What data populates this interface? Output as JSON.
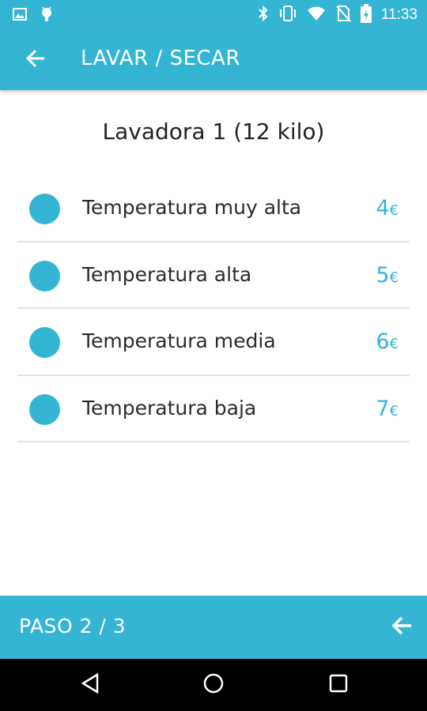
{
  "status_bar": {
    "time": "11:33",
    "left_icons": [
      "image-icon",
      "android-icon"
    ],
    "right_icons": [
      "bluetooth-icon",
      "vibrate-icon",
      "wifi-icon",
      "no-sim-icon",
      "battery-icon"
    ]
  },
  "app_bar": {
    "back_icon": "arrow-left-icon",
    "title": "LAVAR / SECAR"
  },
  "machine": {
    "title": "Lavadora 1 (12 kilo)"
  },
  "options": [
    {
      "label": "Temperatura muy alta",
      "price": "4",
      "currency": "€"
    },
    {
      "label": "Temperatura alta",
      "price": "5",
      "currency": "€"
    },
    {
      "label": "Temperatura media",
      "price": "6",
      "currency": "€"
    },
    {
      "label": "Temperatura baja",
      "price": "7",
      "currency": "€"
    }
  ],
  "step_bar": {
    "label": "PASO 2 / 3",
    "arrow_icon": "arrow-left-icon"
  },
  "nav_bar": {
    "icons": [
      "back-triangle-icon",
      "home-circle-icon",
      "recents-square-icon"
    ]
  },
  "colors": {
    "accent": "#35b5d4",
    "divider": "#e4e4e4",
    "text": "#2b2b2b",
    "nav_background": "#000000"
  }
}
